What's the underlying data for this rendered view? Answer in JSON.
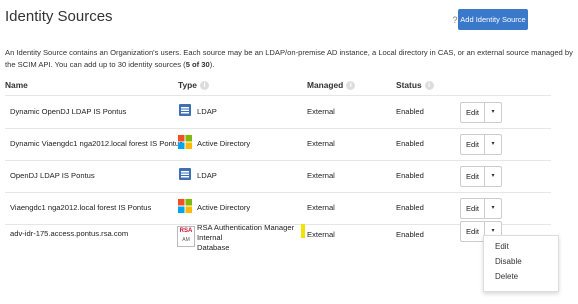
{
  "page": {
    "title": "Identity Sources",
    "help_glyph": "?",
    "add_button": "Add Identity Source",
    "description_text": "An Identity Source contains an Organization's users. Each source may be an LDAP/on-premise AD instance, a Local directory in CAS, or an external source managed by the SCIM API. You can add up to 30 identity sources (",
    "description_count": "5 of 30",
    "description_end": ")."
  },
  "table": {
    "headers": {
      "name": "Name",
      "type": "Type",
      "managed": "Managed",
      "status": "Status"
    },
    "info_glyph": "i",
    "edit_label": "Edit",
    "caret_glyph": "▾",
    "rows": [
      {
        "name": "Dynamic OpenDJ LDAP IS Pontus",
        "type": "LDAP",
        "type_icon": "ldap-icon",
        "managed": "External",
        "status": "Enabled"
      },
      {
        "name": "Dynamic Viaengdc1 nga2012.local forest IS Pontus",
        "type": "Active Directory",
        "type_icon": "active-directory-icon",
        "managed": "External",
        "status": "Enabled"
      },
      {
        "name": "OpenDJ LDAP IS Pontus",
        "type": "LDAP",
        "type_icon": "ldap-icon",
        "managed": "External",
        "status": "Enabled"
      },
      {
        "name": "Viaengdc1 nga2012.local forest IS Pontus",
        "type": "Active Directory",
        "type_icon": "active-directory-icon",
        "managed": "External",
        "status": "Enabled"
      },
      {
        "name": "adv-idr-175.access.pontus.rsa.com",
        "type_line1": "RSA Authentication Manager Internal",
        "type_line2": "Database",
        "type_icon": "rsa-am-icon",
        "rsa_logo_text": "RSA",
        "rsa_logo_sub": "AM",
        "managed": "External",
        "status": "Enabled"
      }
    ]
  },
  "dropdown_menu": {
    "items": [
      "Edit",
      "Disable",
      "Delete"
    ]
  },
  "colors": {
    "accent": "#3a78c9",
    "ldap_blue": "#3f6fb5",
    "ms_red": "#f25022",
    "ms_green": "#7fba00",
    "ms_blue": "#00a4ef",
    "ms_yellow": "#ffb900",
    "rsa_red": "#c8102e"
  }
}
